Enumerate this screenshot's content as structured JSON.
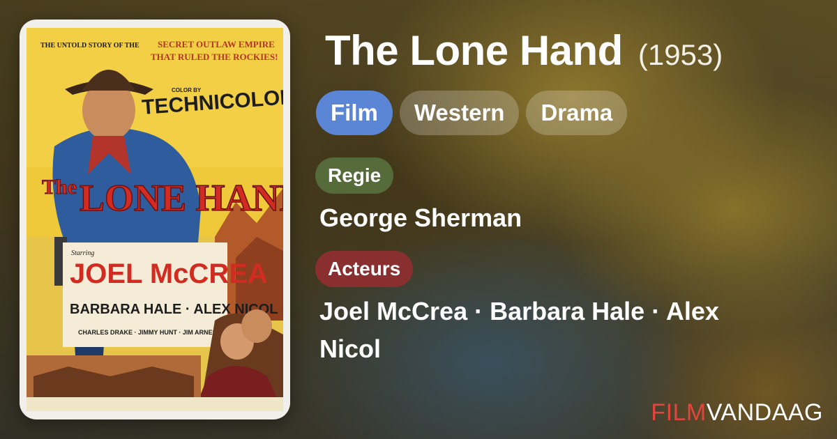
{
  "movie": {
    "title": "The Lone Hand",
    "year": "(1953)"
  },
  "genres": [
    "Film",
    "Western",
    "Drama"
  ],
  "sections": {
    "regie": {
      "label": "Regie",
      "value": "George Sherman"
    },
    "acteurs": {
      "label": "Acteurs",
      "value": "Joel McCrea · Barbara Hale · Alex Nicol"
    }
  },
  "poster": {
    "tagline": "THE UNTOLD STORY OF THE SECRET OUTLAW EMPIRE THAT RULED THE ROCKIES!",
    "color_by": "COLOR BY",
    "technicolor": "TECHNICOLOR",
    "title_the": "The",
    "title_main": "LONE HAND",
    "starring": "Starring",
    "lead": "JOEL McCREA",
    "costars": "BARBARA HALE · ALEX NICOL",
    "supporting": "CHARLES DRAKE · JIMMY HUNT · JIM ARNESS"
  },
  "brand": {
    "part1": "FILM",
    "part2": "VANDAAG"
  },
  "colors": {
    "chip_primary": "#5b86d6",
    "chip_regie": "#566b3a",
    "chip_acteurs": "#8a2f2f",
    "brand_red": "#e2453d"
  }
}
